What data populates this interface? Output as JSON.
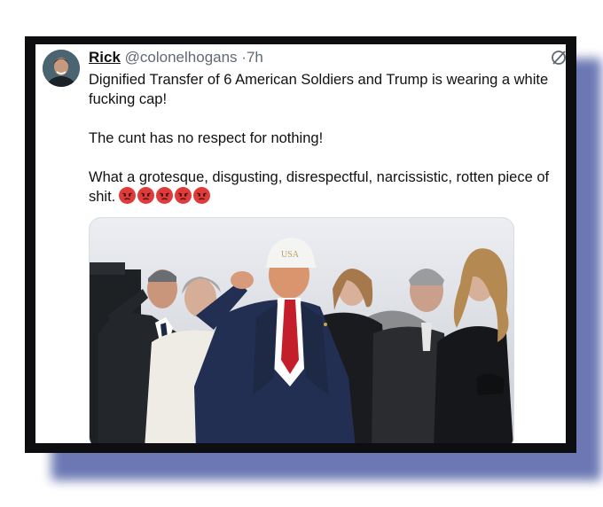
{
  "tweet": {
    "display_name": "Rick",
    "handle": "@colonelhogans",
    "separator": "·",
    "time": "7h",
    "paragraphs": [
      "Dignified Transfer of 6 American Soldiers and Trump is wearing a white",
      "fucking cap!",
      "The cunt has no respect for nothing!",
      "What a grotesque, disgusting, disrespectful, narcissistic, rotten piece of",
      "shit."
    ],
    "emojis": [
      "angry-face-icon",
      "angry-face-icon",
      "angry-face-icon",
      "angry-face-icon",
      "angry-face-icon"
    ]
  },
  "media": {
    "cap_text": "USA"
  },
  "colors": {
    "frame": "#0e0e10",
    "shadow": "#6b78b4",
    "emoji": "#e03b3b",
    "handle": "#5e6a72"
  }
}
